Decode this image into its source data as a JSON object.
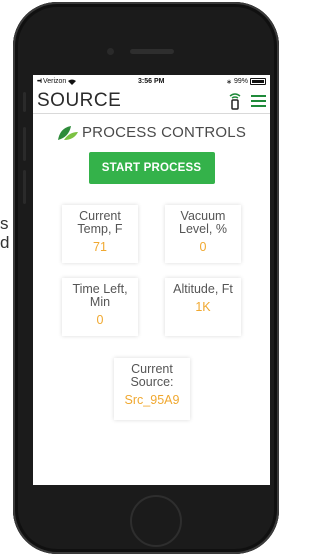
{
  "edge_text": {
    "line1": "s",
    "line2": "d"
  },
  "status_bar": {
    "carrier": "Verizon",
    "time": "3:56 PM",
    "battery": "99%"
  },
  "header": {
    "brand": "SOURCE"
  },
  "main": {
    "title": "PROCESS CONTROLS",
    "start_label": "START PROCESS",
    "cards": [
      {
        "label": "Current Temp, F",
        "value": "71"
      },
      {
        "label": "Vacuum Level, %",
        "value": "0"
      },
      {
        "label": "Time Left, Min",
        "value": "0"
      },
      {
        "label": "Altitude, Ft",
        "value": "1K"
      },
      {
        "label": "Current Source:",
        "value": "Src_95A9"
      }
    ]
  },
  "colors": {
    "accent_green": "#34b24a",
    "value_orange": "#f0a830",
    "leaf_dark": "#2e8b3a",
    "leaf_light": "#7cc243"
  },
  "icons": [
    "wifi-icon",
    "bluetooth-icon",
    "battery-icon",
    "leaf-logo-icon",
    "device-icon",
    "menu-icon"
  ]
}
